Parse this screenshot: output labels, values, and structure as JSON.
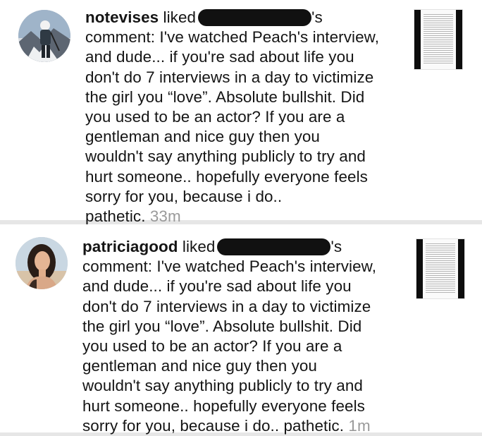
{
  "notifications": [
    {
      "username": "notevises",
      "action": "liked",
      "possessive": "'s",
      "lines": [
        "comment: I've watched Peach's interview,",
        "and dude... if you're sad about life you",
        "don't do 7 interviews in a day to victimize",
        "the girl you “love”. Absolute bullshit. Did",
        "you used to be an actor? If you are a",
        "gentleman and nice guy then you",
        "wouldn't say anything publicly to try and",
        "hurt someone.. hopefully everyone feels",
        "sorry for you, because i do.."
      ],
      "last_line": "pathetic.",
      "timestamp": "33m",
      "avatar_icon": "user-avatar-climber",
      "thumbnail_icon": "post-thumbnail-document"
    },
    {
      "username": "patriciagood",
      "action": "liked",
      "possessive": "'s",
      "lines": [
        "comment: I've watched Peach's interview,",
        "and dude... if you're sad about life you",
        "don't do 7 interviews in a day to victimize",
        "the girl you “love”. Absolute bullshit. Did",
        "you used to be an actor? If you are a",
        "gentleman and nice guy then you",
        "wouldn't say anything publicly to try and",
        "hurt someone.. hopefully everyone feels"
      ],
      "last_line": "sorry for you, because i do.. pathetic.",
      "timestamp": "1m",
      "avatar_icon": "user-avatar-woman",
      "thumbnail_icon": "post-thumbnail-document"
    }
  ],
  "colors": {
    "text": "#141414",
    "timestamp": "#9a9a9a",
    "redaction": "#111111",
    "separator": "#e6e6e6"
  }
}
